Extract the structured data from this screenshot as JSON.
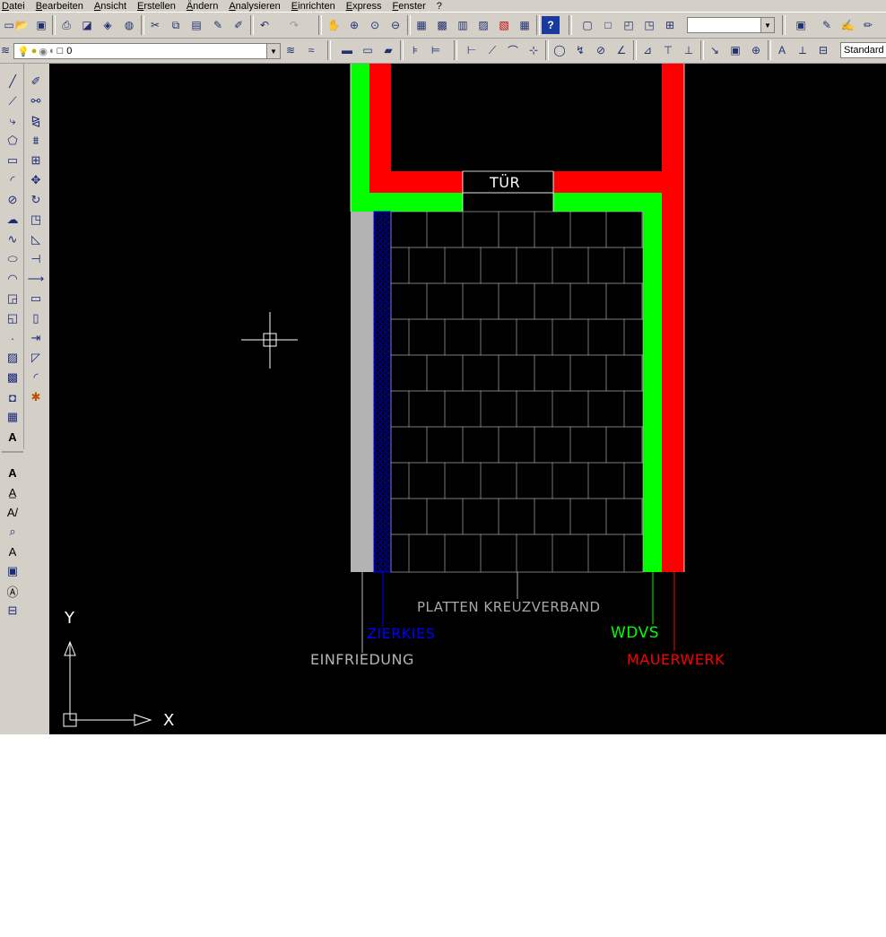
{
  "menu": [
    "Datei",
    "Bearbeiten",
    "Ansicht",
    "Erstellen",
    "Ändern",
    "Analysieren",
    "Einrichten",
    "Express",
    "Fenster",
    "?"
  ],
  "toolbar1": {
    "icons": [
      "new-icon",
      "open-icon",
      "save-icon",
      "print-icon",
      "plot-preview-icon",
      "publish-icon",
      "etransmit-icon",
      "cut-icon",
      "copy-icon",
      "paste-icon",
      "match-properties-icon",
      "block-editor-icon",
      "undo-icon",
      "redo-icon",
      "pan-icon",
      "zoom-realtime-icon",
      "zoom-window-icon",
      "zoom-previous-icon",
      "properties-icon",
      "design-center-icon",
      "tool-palettes-icon",
      "sheet-set-icon",
      "markup-icon",
      "calculator-icon",
      "help-icon"
    ],
    "view_combo_value": "",
    "right_icons": [
      "viewport-icon",
      "single-viewport-icon",
      "clip-icon",
      "scale-icon",
      "layout-icon",
      "draw-order-icon",
      "edit-icon",
      "pen-icon"
    ]
  },
  "toolbar2": {
    "layer_value": "0",
    "text_style_value": "Standard"
  },
  "drawing": {
    "door_label": "TÜR",
    "labels": {
      "platten": "PLATTEN KREUZVERBAND",
      "zierkies": "ZIERKIES",
      "wdvs": "WDVS",
      "einfriedung": "EINFRIEDUNG",
      "mauerwerk": "MAUERWERK"
    },
    "ucs": {
      "x": "X",
      "y": "Y"
    },
    "colors": {
      "mauerwerk": "#ff0000",
      "wdvs": "#00ff00",
      "einfriedung": "#b3b3b3",
      "zierkies": "#0000ff",
      "platten": "#a8a8a8",
      "canvas": "#000000"
    }
  }
}
